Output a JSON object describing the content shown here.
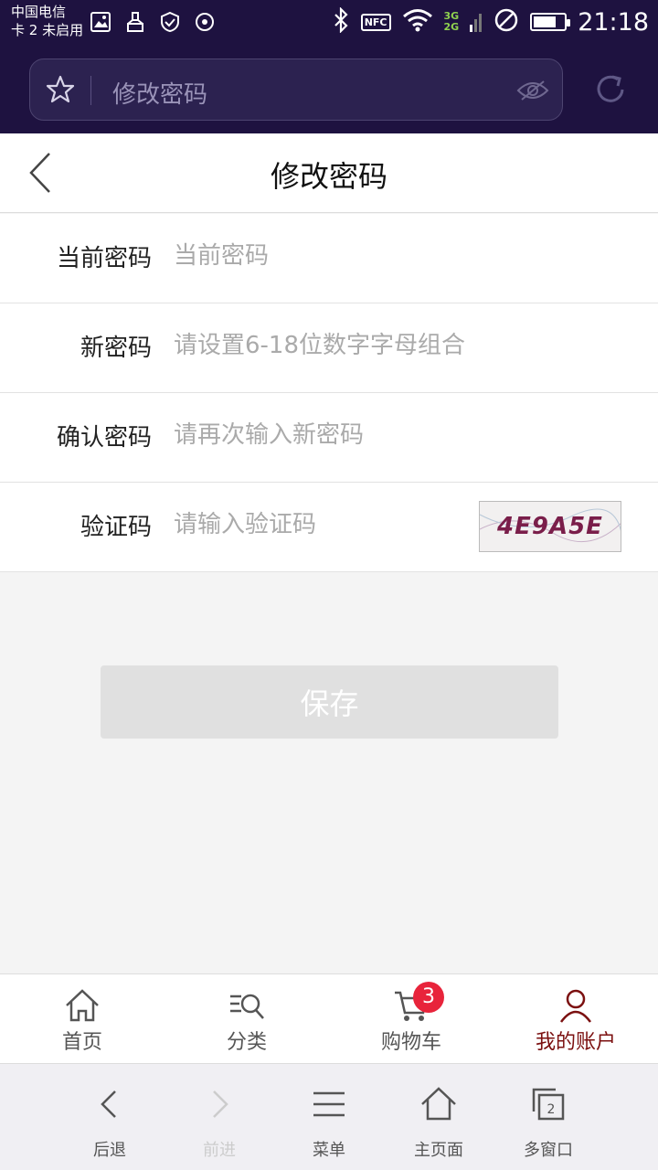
{
  "status_bar": {
    "carrier_line1": "中国电信",
    "carrier_line2": "卡 2 未启用",
    "nfc": "NFC",
    "network": "3G\n2G",
    "battery_level": 0.75,
    "time": "21:18"
  },
  "browser": {
    "url_text": "修改密码"
  },
  "header": {
    "title": "修改密码"
  },
  "form": {
    "rows": [
      {
        "label": "当前密码",
        "placeholder": "当前密码",
        "value": ""
      },
      {
        "label": "新密码",
        "placeholder": "请设置6-18位数字字母组合",
        "value": ""
      },
      {
        "label": "确认密码",
        "placeholder": "请再次输入新密码",
        "value": ""
      },
      {
        "label": "验证码",
        "placeholder": "请输入验证码",
        "value": ""
      }
    ],
    "captcha_text": "4E9A5E",
    "save_label": "保存"
  },
  "app_tabs": {
    "items": [
      {
        "label": "首页",
        "icon": "home-icon"
      },
      {
        "label": "分类",
        "icon": "category-search-icon"
      },
      {
        "label": "购物车",
        "icon": "cart-icon",
        "badge": "3"
      },
      {
        "label": "我的账户",
        "icon": "user-icon"
      }
    ],
    "active_index": 3,
    "active_color": "#7b1010",
    "badge_color": "#e8243b"
  },
  "browser_nav": {
    "items": [
      {
        "label": "后退",
        "icon": "back-icon"
      },
      {
        "label": "前进",
        "icon": "forward-icon"
      },
      {
        "label": "菜单",
        "icon": "menu-icon"
      },
      {
        "label": "主页面",
        "icon": "home-icon"
      },
      {
        "label": "多窗口",
        "icon": "windows-icon",
        "count": "2"
      }
    ]
  },
  "colors": {
    "status_bg": "#1e1240",
    "save_disabled": "#e0e0e0"
  }
}
